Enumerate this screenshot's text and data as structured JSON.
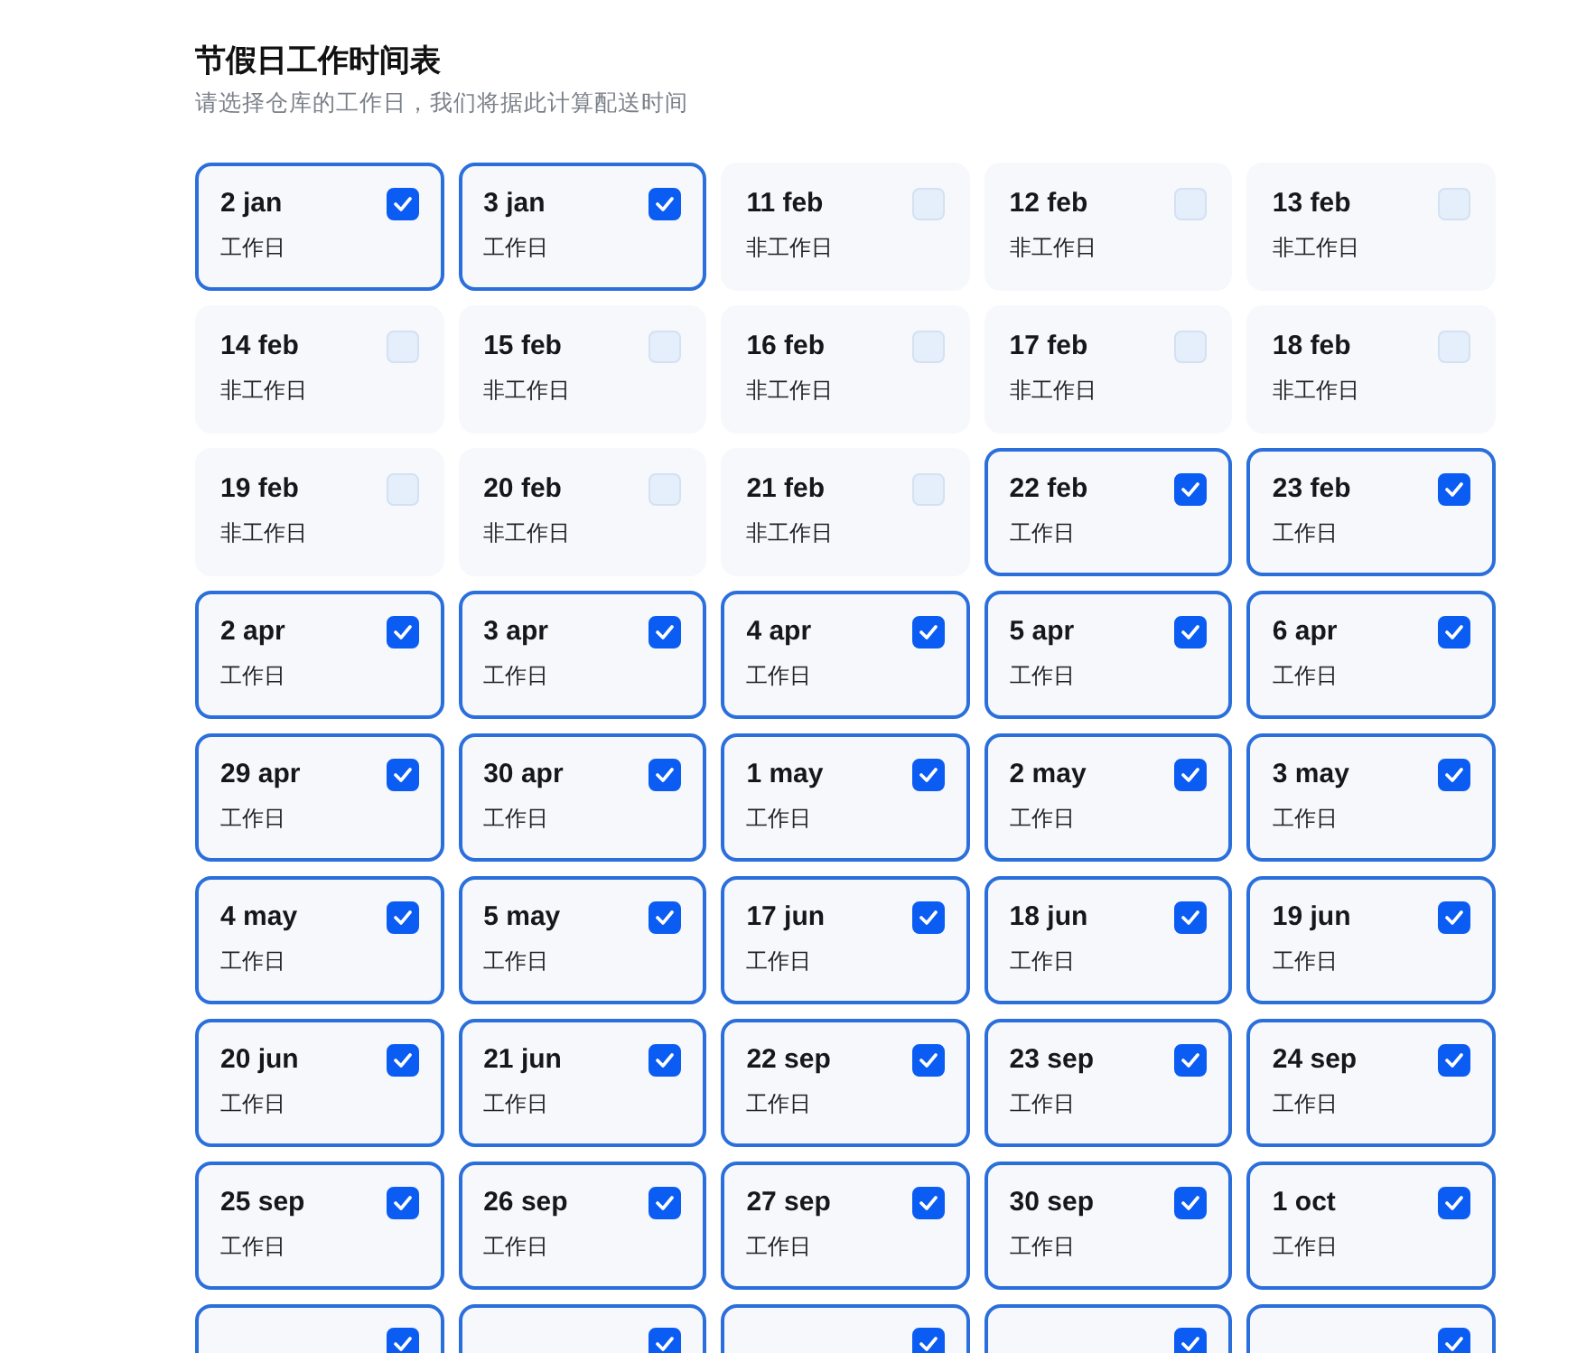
{
  "title": "节假日工作时间表",
  "subtitle": "请选择仓库的工作日，我们将据此计算配送时间",
  "days": [
    {
      "date": "2 jan",
      "label": "工作日",
      "checked": true
    },
    {
      "date": "3 jan",
      "label": "工作日",
      "checked": true
    },
    {
      "date": "11 feb",
      "label": "非工作日",
      "checked": false
    },
    {
      "date": "12 feb",
      "label": "非工作日",
      "checked": false
    },
    {
      "date": "13 feb",
      "label": "非工作日",
      "checked": false
    },
    {
      "date": "14 feb",
      "label": "非工作日",
      "checked": false
    },
    {
      "date": "15 feb",
      "label": "非工作日",
      "checked": false
    },
    {
      "date": "16 feb",
      "label": "非工作日",
      "checked": false
    },
    {
      "date": "17 feb",
      "label": "非工作日",
      "checked": false
    },
    {
      "date": "18 feb",
      "label": "非工作日",
      "checked": false
    },
    {
      "date": "19 feb",
      "label": "非工作日",
      "checked": false
    },
    {
      "date": "20 feb",
      "label": "非工作日",
      "checked": false
    },
    {
      "date": "21 feb",
      "label": "非工作日",
      "checked": false
    },
    {
      "date": "22 feb",
      "label": "工作日",
      "checked": true
    },
    {
      "date": "23 feb",
      "label": "工作日",
      "checked": true
    },
    {
      "date": "2 apr",
      "label": "工作日",
      "checked": true
    },
    {
      "date": "3 apr",
      "label": "工作日",
      "checked": true
    },
    {
      "date": "4 apr",
      "label": "工作日",
      "checked": true
    },
    {
      "date": "5 apr",
      "label": "工作日",
      "checked": true
    },
    {
      "date": "6 apr",
      "label": "工作日",
      "checked": true
    },
    {
      "date": "29 apr",
      "label": "工作日",
      "checked": true
    },
    {
      "date": "30 apr",
      "label": "工作日",
      "checked": true
    },
    {
      "date": "1 may",
      "label": "工作日",
      "checked": true
    },
    {
      "date": "2 may",
      "label": "工作日",
      "checked": true
    },
    {
      "date": "3 may",
      "label": "工作日",
      "checked": true
    },
    {
      "date": "4 may",
      "label": "工作日",
      "checked": true
    },
    {
      "date": "5 may",
      "label": "工作日",
      "checked": true
    },
    {
      "date": "17 jun",
      "label": "工作日",
      "checked": true
    },
    {
      "date": "18 jun",
      "label": "工作日",
      "checked": true
    },
    {
      "date": "19 jun",
      "label": "工作日",
      "checked": true
    },
    {
      "date": "20 jun",
      "label": "工作日",
      "checked": true
    },
    {
      "date": "21 jun",
      "label": "工作日",
      "checked": true
    },
    {
      "date": "22 sep",
      "label": "工作日",
      "checked": true
    },
    {
      "date": "23 sep",
      "label": "工作日",
      "checked": true
    },
    {
      "date": "24 sep",
      "label": "工作日",
      "checked": true
    },
    {
      "date": "25 sep",
      "label": "工作日",
      "checked": true
    },
    {
      "date": "26 sep",
      "label": "工作日",
      "checked": true
    },
    {
      "date": "27 sep",
      "label": "工作日",
      "checked": true
    },
    {
      "date": "30 sep",
      "label": "工作日",
      "checked": true
    },
    {
      "date": "1 oct",
      "label": "工作日",
      "checked": true
    },
    {
      "checked": true
    },
    {
      "checked": true
    },
    {
      "checked": true
    },
    {
      "checked": true
    },
    {
      "checked": true
    }
  ]
}
